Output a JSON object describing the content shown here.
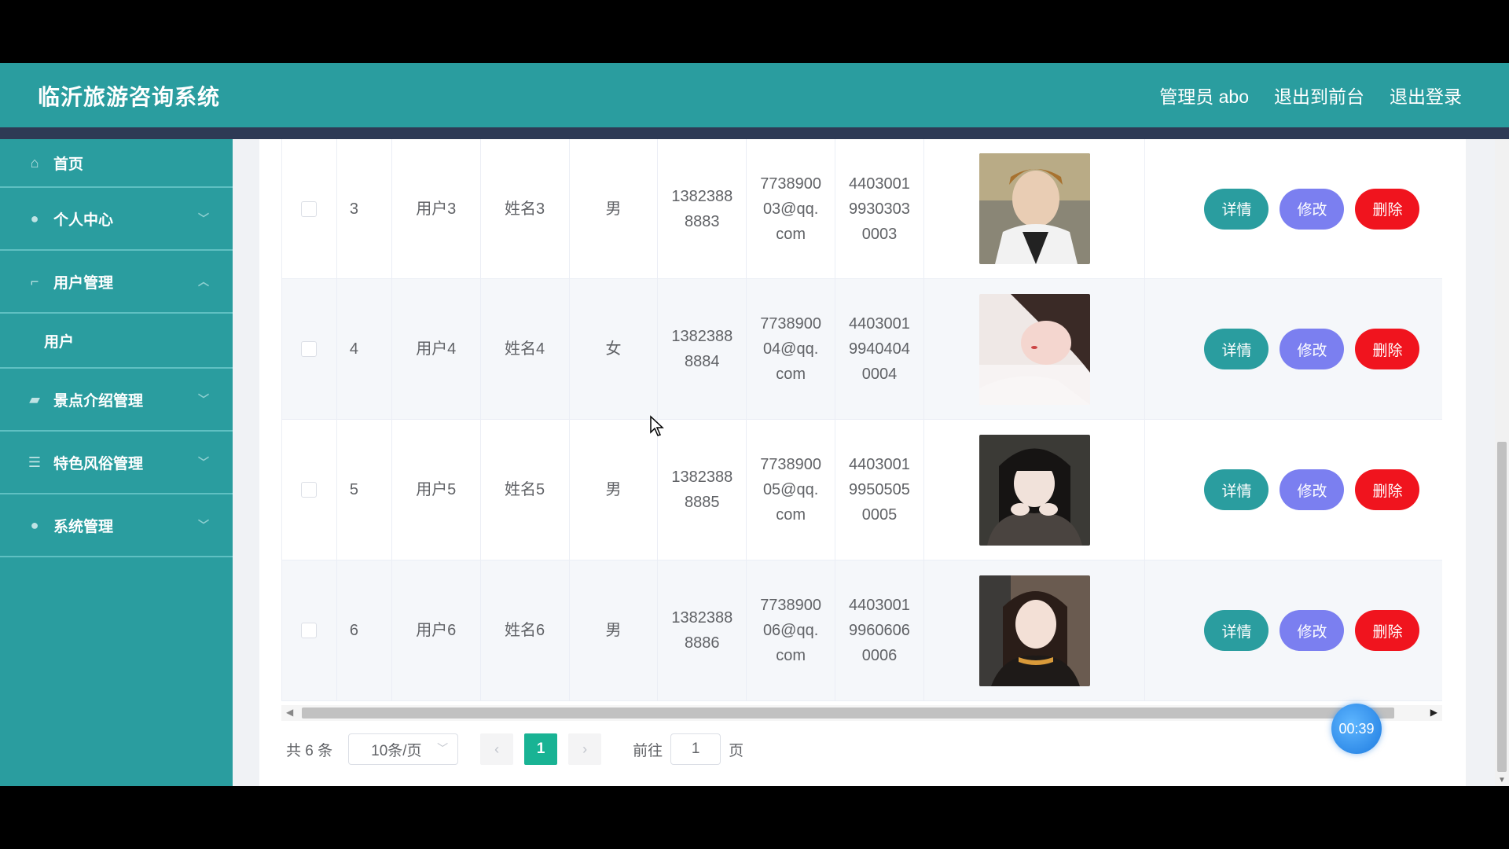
{
  "header": {
    "title": "临沂旅游咨询系统",
    "admin": "管理员 abo",
    "to_front": "退出到前台",
    "logout": "退出登录"
  },
  "sidebar": {
    "items": [
      {
        "label": "首页",
        "icon": "home-icon"
      },
      {
        "label": "个人中心",
        "icon": "user-icon"
      },
      {
        "label": "用户管理",
        "icon": "crop-icon"
      },
      {
        "label": "用户",
        "icon": ""
      },
      {
        "label": "景点介绍管理",
        "icon": "briefcase-icon"
      },
      {
        "label": "特色风俗管理",
        "icon": "list-icon"
      },
      {
        "label": "系统管理",
        "icon": "user-icon"
      }
    ]
  },
  "table": {
    "rows": [
      {
        "idx": "3",
        "account": "用户3",
        "name": "姓名3",
        "sex": "男",
        "phone": "1382388\n8883",
        "mail": "7738900\n03@qq.\ncom",
        "id": "4403001\n9930303\n0003"
      },
      {
        "idx": "4",
        "account": "用户4",
        "name": "姓名4",
        "sex": "女",
        "phone": "1382388\n8884",
        "mail": "7738900\n04@qq.\ncom",
        "id": "4403001\n9940404\n0004"
      },
      {
        "idx": "5",
        "account": "用户5",
        "name": "姓名5",
        "sex": "男",
        "phone": "1382388\n8885",
        "mail": "7738900\n05@qq.\ncom",
        "id": "4403001\n9950505\n0005"
      },
      {
        "idx": "6",
        "account": "用户6",
        "name": "姓名6",
        "sex": "男",
        "phone": "1382388\n8886",
        "mail": "7738900\n06@qq.\ncom",
        "id": "4403001\n9960606\n0006"
      }
    ],
    "btn_detail": "详情",
    "btn_edit": "修改",
    "btn_delete": "删除"
  },
  "pagination": {
    "total": "共 6 条",
    "page_size": "10条/页",
    "current": "1",
    "goto_label": "前往",
    "goto_value": "1",
    "page_unit": "页"
  },
  "timer": "00:39",
  "colors": {
    "primary": "#2a9d9f",
    "edit": "#7b7ff0",
    "delete": "#f0141e",
    "page_active": "#19b394"
  }
}
